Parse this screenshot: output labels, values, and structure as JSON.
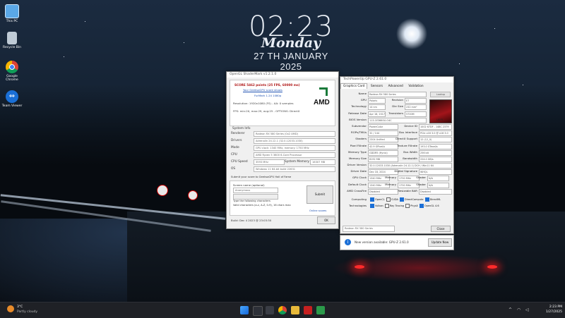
{
  "desktop": {
    "icons": [
      {
        "label": "This PC",
        "color": "#5aa8e8"
      },
      {
        "label": "Recycle Bin",
        "color": "#bfcbd6"
      },
      {
        "label": "Google Chrome",
        "color": "#e2b22a"
      },
      {
        "label": "Team Viewer",
        "color": "#1a6fd6"
      }
    ],
    "clock": {
      "time": "02:23",
      "day": "Monday",
      "date": "27 TH JANUARY 2025"
    }
  },
  "benchmark_window": {
    "title": "OpenGL ShaderMark v1.2.1.0",
    "score_line": "SCORE 5462 points (25 FPS, 60000 ms)",
    "compare_link": "Your GeeksoGPU score shows",
    "settings_line": "FurMark 1.24 1080p",
    "resolution_line": "Resolution: 1920x1080 (FS) - AA: 0 samples",
    "fps_line": "FPS: min:20, max:29, avg:25 - OPTIONS: DirectX",
    "brand": "AMD",
    "system_info_label": "System Info",
    "rows": [
      {
        "label": "Renderer",
        "value": "Radeon RX 580 Series (0x2 AMD)"
      },
      {
        "label": "Drivers",
        "value": "Adrenalin 24.12.1 (32.0.12033.1030)"
      },
      {
        "label": "Mode",
        "value": "GPU clock: 1340 MHz, memory: 1750 MHz"
      },
      {
        "label": "CPU",
        "value": "AMD Ryzen 5 3600 6-Core Processor"
      },
      {
        "label": "CPU Speed",
        "value": "3593 MHz"
      },
      {
        "label": "OS",
        "value": "Windows 11 64-bit build 22631"
      }
    ],
    "memory_label": "System Memory",
    "memory_value": "16307 MB",
    "submit_note": "Submit your score to GeeksoGPU Hall of Fame",
    "username_label": "Screen name (optional)",
    "username_value": "Anonymous",
    "captcha_label": "Type the following characters",
    "captcha_text": "Valid characters (a-z, A-Z, 0-9), 16 chars max",
    "submit_button": "Submit",
    "online_link": "Online scores",
    "build_label": "Build: Dec 4 2023 @ 23:03:30",
    "close_button": "OK"
  },
  "gpuz": {
    "title": "TechPowerUp GPU-Z 2.61.0",
    "tabs": [
      "Graphics Card",
      "Sensors",
      "Advanced",
      "Validation"
    ],
    "rows": [
      {
        "k": "Name",
        "v": "Radeon RX 580 Series",
        "extra": "Lookup"
      },
      {
        "k": "GPU",
        "v": "Polaris",
        "k2": "Revision",
        "v2": "E7"
      },
      {
        "k": "Technology",
        "v": "14 nm",
        "k2": "Die Size",
        "v2": "232 mm²"
      },
      {
        "k": "Release Date",
        "v": "Apr 18, 2017",
        "k2": "Transistors",
        "v2": "5700M"
      },
      {
        "k": "BIOS Version",
        "v": "113-1E3660U-O4C"
      },
      {
        "k": "Subvendor",
        "v": "PowerColor",
        "k2": "Device ID",
        "v2": "1002 67DF - 148C 2379"
      },
      {
        "k": "ROPs/TMUs",
        "v": "32 / 144",
        "k2": "Bus Interface",
        "v2": "PCIe x16 3.0 @ x16 3.0"
      },
      {
        "k": "Shaders",
        "v": "2304 Unified",
        "k2": "DirectX Support",
        "v2": "12 (12_0)"
      },
      {
        "k": "Pixel Fillrate",
        "v": "42.9 GPixel/s",
        "k2": "Texture Fillrate",
        "v2": "193.0 GTexel/s"
      },
      {
        "k": "Memory Type",
        "v": "GDDR5 (Hynix)",
        "k2": "Bus Width",
        "v2": "256 bit"
      },
      {
        "k": "Memory Size",
        "v": "8192 MB",
        "k2": "Bandwidth",
        "v2": "224.0 GB/s"
      },
      {
        "k": "Driver Version",
        "v": "32.0.12033.1030 (Adrenalin 24.12.1) DCH / Win11 64"
      },
      {
        "k": "Driver Date",
        "v": "Dec 18, 2024",
        "k2": "Digital Signature",
        "v2": "WHQL"
      },
      {
        "k": "GPU Clock",
        "v": "1340 MHz",
        "k2": "Memory",
        "v2": "1750 MHz",
        "k3": "Shader",
        "v3": "N/A"
      },
      {
        "k": "Default Clock",
        "v": "1340 MHz",
        "k2": "Memory",
        "v2": "1750 MHz",
        "k3": "Shader",
        "v3": "N/A"
      },
      {
        "k": "AMD CrossFire",
        "v": "Disabled",
        "k2": "Resizable BAR",
        "v2": "Disabled"
      }
    ],
    "computing_label": "Computing",
    "computing": [
      "OpenCL",
      "CUDA",
      "DirectCompute",
      "DirectML"
    ],
    "technologies_label": "Technologies",
    "technologies": [
      "Vulkan",
      "Ray Tracing",
      "PhysX",
      "OpenGL 4.6"
    ],
    "uefi_label": "UEFI",
    "selected_gpu": "Radeon RX 580 Series",
    "close_button": "Close"
  },
  "notice": {
    "text": "New version available: GPU-Z 2.61.0",
    "button": "Update Now"
  },
  "taskbar": {
    "weather_temp": "3°C",
    "weather_text": "Partly cloudy",
    "clock_time": "2:23 PM",
    "clock_date": "1/27/2025"
  }
}
